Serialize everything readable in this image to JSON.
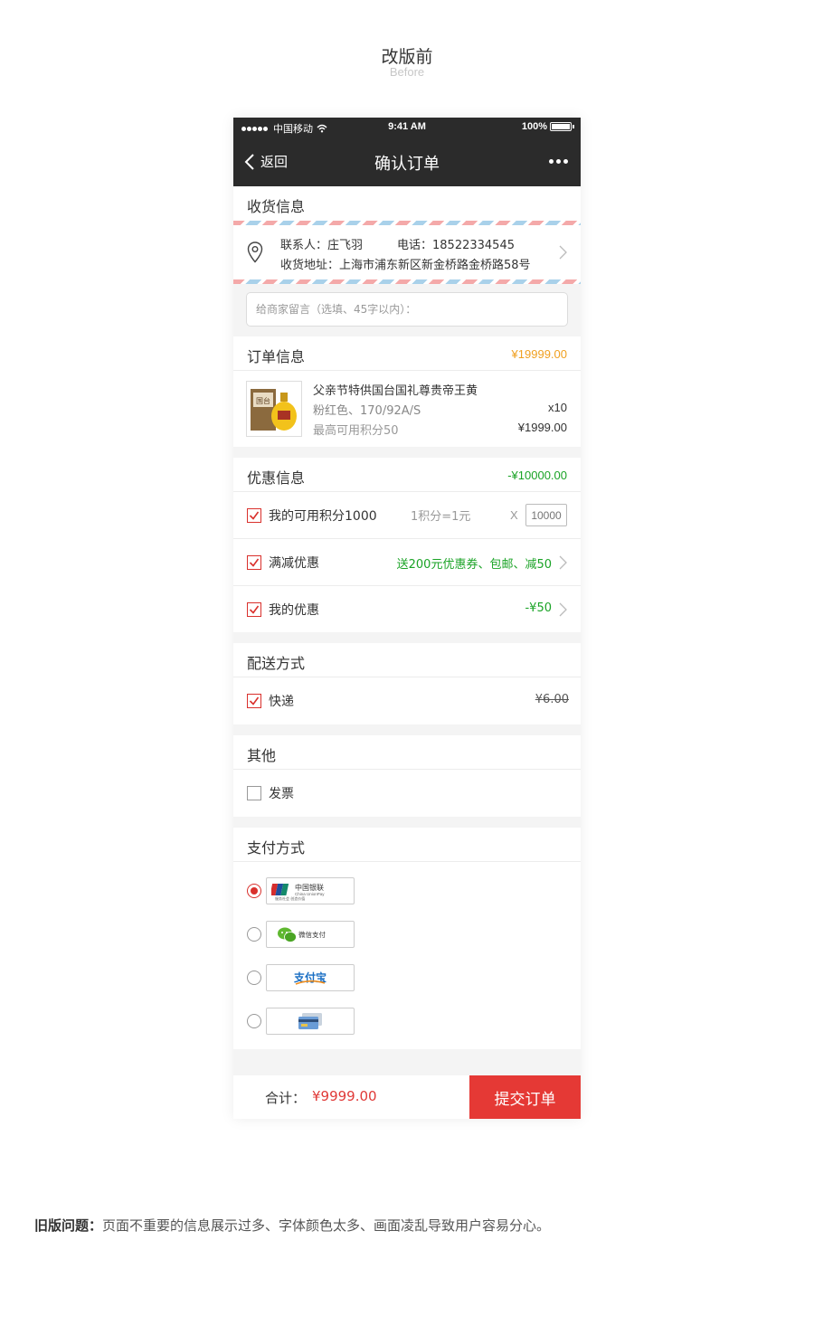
{
  "heading": {
    "title": "改版前",
    "subtitle": "Before"
  },
  "status_bar": {
    "carrier": "中国移动",
    "time": "9:41 AM",
    "battery": "100%"
  },
  "nav": {
    "back_label": "返回",
    "title": "确认订单"
  },
  "shipping": {
    "title": "收货信息",
    "contact": "联系人：庄飞羽",
    "phone": "电话：18522334545",
    "address": "收货地址：上海市浦东新区新金桥路金桥路58号"
  },
  "message": {
    "placeholder": "给商家留言（选填、45字以内）："
  },
  "order": {
    "title": "订单信息",
    "amount": "¥19999.00",
    "amount_color": "#f0a020",
    "product": {
      "name": "父亲节特供国台国礼尊贵帝王黄",
      "variant": "粉红色、170/92A/S",
      "points": "最高可用积分50",
      "qty": "x10",
      "price": "¥1999.00",
      "image": "liquor-bottle-gift-box"
    }
  },
  "discount": {
    "title": "优惠信息",
    "amount": "-¥10000.00",
    "amount_color": "#1aa326",
    "points_label": "我的可用积分1000",
    "points_rate": "1积分=1元",
    "points_x": "X",
    "points_value": "10000",
    "promo_label": "满减优惠",
    "promo_value": "送200元优惠券、包邮、减50",
    "coupon_label": "我的优惠",
    "coupon_value": "-¥50"
  },
  "delivery": {
    "title": "配送方式",
    "method": "快递",
    "fee": "¥6.00"
  },
  "other": {
    "title": "其他",
    "invoice": "发票"
  },
  "payment": {
    "title": "支付方式",
    "options": [
      {
        "name": "unionpay",
        "label_cn": "中国银联",
        "label_en": "China UnionPay",
        "slogan": "服务社会 创造价值",
        "selected": true
      },
      {
        "name": "wechat-pay",
        "label_cn": "微信支付",
        "selected": false
      },
      {
        "name": "alipay",
        "label_cn": "支付宝",
        "selected": false
      },
      {
        "name": "bank-card",
        "label_cn": "",
        "selected": false
      }
    ]
  },
  "footer": {
    "total_label": "合计：",
    "total_value": "¥9999.00",
    "submit_label": "提交订单",
    "accent": "#e53935"
  },
  "note": {
    "label": "旧版问题：",
    "text": "页面不重要的信息展示过多、字体颜色太多、画面凌乱导致用户容易分心。"
  }
}
